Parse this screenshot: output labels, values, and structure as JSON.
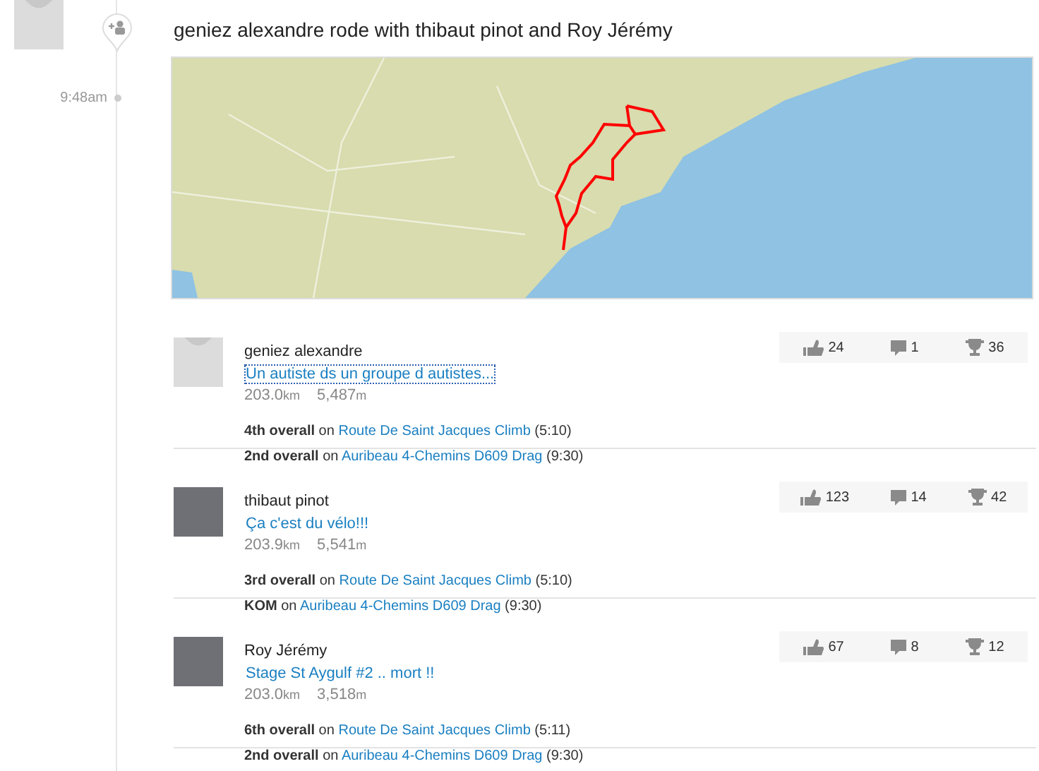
{
  "feed_item": {
    "title": "geniez alexandre rode with thibaut pinot and Roy Jérémy",
    "time": "9:48am",
    "avatar": {
      "kind": "placeholder"
    }
  },
  "entries": [
    {
      "avatar": {
        "kind": "placeholder"
      },
      "athlete": "geniez alexandre",
      "activity": "Un autiste ds un groupe d autistes...",
      "focused": true,
      "distance": "203.0",
      "distance_unit": "km",
      "elevation": "5,487",
      "elevation_unit": "m",
      "kudos": "24",
      "comments": "1",
      "achievements": "36",
      "efforts": [
        {
          "rank": "4th overall",
          "connector": "on",
          "segment": "Route De Saint Jacques Climb",
          "time": "(5:10)"
        },
        {
          "rank": "2nd overall",
          "connector": "on",
          "segment": "Auribeau 4-Chemins D609 Drag",
          "time": "(9:30)"
        }
      ]
    },
    {
      "avatar": {
        "kind": "photo"
      },
      "athlete": "thibaut pinot",
      "activity": "Ça c'est du vélo!!!",
      "focused": false,
      "distance": "203.9",
      "distance_unit": "km",
      "elevation": "5,541",
      "elevation_unit": "m",
      "kudos": "123",
      "comments": "14",
      "achievements": "42",
      "efforts": [
        {
          "rank": "3rd overall",
          "connector": "on",
          "segment": "Route De Saint Jacques Climb",
          "time": "(5:10)"
        },
        {
          "rank": "KOM",
          "connector": "on",
          "segment": "Auribeau 4-Chemins D609 Drag",
          "time": "(9:30)"
        }
      ]
    },
    {
      "avatar": {
        "kind": "photo"
      },
      "athlete": "Roy Jérémy",
      "activity": "Stage St Aygulf #2 .. mort !!",
      "focused": false,
      "distance": "203.0",
      "distance_unit": "km",
      "elevation": "3,518",
      "elevation_unit": "m",
      "kudos": "67",
      "comments": "8",
      "achievements": "12",
      "efforts": [
        {
          "rank": "6th overall",
          "connector": "on",
          "segment": "Route De Saint Jacques Climb",
          "time": "(5:11)"
        },
        {
          "rank": "2nd overall",
          "connector": "on",
          "segment": "Auribeau 4-Chemins D609 Drag",
          "time": "(9:30)"
        }
      ]
    }
  ]
}
